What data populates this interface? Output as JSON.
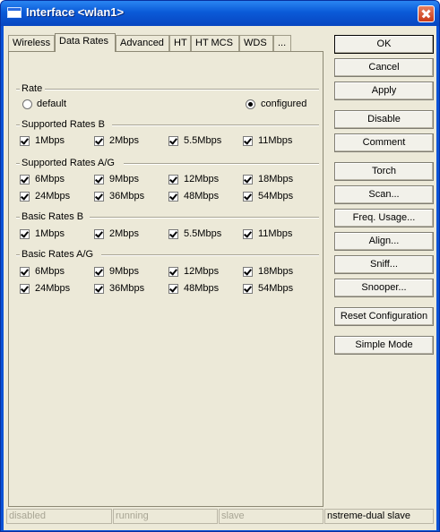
{
  "window": {
    "title": "Interface <wlan1>"
  },
  "tabs": [
    "Wireless",
    "Data Rates",
    "Advanced",
    "HT",
    "HT MCS",
    "WDS",
    "..."
  ],
  "rate": {
    "title": "Rate",
    "default_label": "default",
    "configured_label": "configured",
    "selected": "configured"
  },
  "supported_rates_b": {
    "title": "Supported Rates B",
    "items": [
      "1Mbps",
      "2Mbps",
      "5.5Mbps",
      "11Mbps"
    ]
  },
  "supported_rates_ag": {
    "title": "Supported Rates A/G",
    "items": [
      "6Mbps",
      "9Mbps",
      "12Mbps",
      "18Mbps",
      "24Mbps",
      "36Mbps",
      "48Mbps",
      "54Mbps"
    ]
  },
  "basic_rates_b": {
    "title": "Basic Rates B",
    "items": [
      "1Mbps",
      "2Mbps",
      "5.5Mbps",
      "11Mbps"
    ]
  },
  "basic_rates_ag": {
    "title": "Basic Rates A/G",
    "items": [
      "6Mbps",
      "9Mbps",
      "12Mbps",
      "18Mbps",
      "24Mbps",
      "36Mbps",
      "48Mbps",
      "54Mbps"
    ]
  },
  "buttons": {
    "ok": "OK",
    "cancel": "Cancel",
    "apply": "Apply",
    "disable": "Disable",
    "comment": "Comment",
    "torch": "Torch",
    "scan": "Scan...",
    "freq_usage": "Freq. Usage...",
    "align": "Align...",
    "sniff": "Sniff...",
    "snooper": "Snooper...",
    "reset_configuration": "Reset Configuration",
    "simple_mode": "Simple Mode"
  },
  "status": {
    "disabled": "disabled",
    "running": "running",
    "slave": "slave",
    "mode": "nstreme-dual slave"
  },
  "colors": {
    "titlebar": "#0a5ad8",
    "client_bg": "#ece9d8",
    "close_button": "#c83a18"
  }
}
